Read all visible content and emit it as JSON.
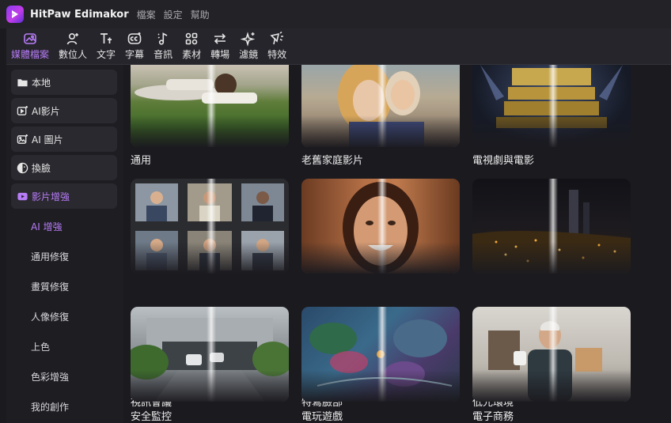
{
  "app": {
    "title": "HitPaw Edimakor",
    "menu": [
      "檔案",
      "設定",
      "幫助"
    ]
  },
  "toolbar": {
    "accent_color": "#b77cf7",
    "tabs": [
      {
        "label": "媒體檔案",
        "icon": "media-icon",
        "active": true
      },
      {
        "label": "數位人",
        "icon": "avatar-add-icon",
        "active": false
      },
      {
        "label": "文字",
        "icon": "text-icon",
        "active": false
      },
      {
        "label": "字幕",
        "icon": "subtitle-icon",
        "active": false
      },
      {
        "label": "音訊",
        "icon": "audio-icon",
        "active": false
      },
      {
        "label": "素材",
        "icon": "assets-icon",
        "active": false
      },
      {
        "label": "轉場",
        "icon": "transition-icon",
        "active": false
      },
      {
        "label": "濾鏡",
        "icon": "filter-icon",
        "active": false
      },
      {
        "label": "特效",
        "icon": "effects-icon",
        "active": false
      }
    ]
  },
  "sidebar": {
    "items": [
      {
        "label": "本地",
        "icon": "folder-icon",
        "active": false
      },
      {
        "label": "AI影片",
        "icon": "ai-video-icon",
        "active": false
      },
      {
        "label": "AI 圖片",
        "icon": "ai-image-icon",
        "active": false
      },
      {
        "label": "換臉",
        "icon": "face-swap-icon",
        "active": false
      },
      {
        "label": "影片增強",
        "icon": "video-enhance-icon",
        "active": true
      }
    ],
    "subitems": [
      {
        "label": "AI 增強",
        "active": true
      },
      {
        "label": "通用修復",
        "active": false
      },
      {
        "label": "畫質修復",
        "active": false
      },
      {
        "label": "人像修復",
        "active": false
      },
      {
        "label": "上色",
        "active": false
      },
      {
        "label": "色彩增強",
        "active": false
      },
      {
        "label": "我的創作",
        "active": false
      }
    ]
  },
  "grid": {
    "cards": [
      {
        "label": "通用",
        "scene": "grass-reading"
      },
      {
        "label": "老舊家庭影片",
        "scene": "family-portrait"
      },
      {
        "label": "電視劇與電影",
        "scene": "studio-logo"
      },
      {
        "label": "視訊會議",
        "scene": "video-call-grid"
      },
      {
        "label": "特寫臉部",
        "scene": "smiling-face"
      },
      {
        "label": "低光環境",
        "scene": "night-city"
      },
      {
        "label": "安全監控",
        "scene": "security-camera"
      },
      {
        "label": "電玩遊戲",
        "scene": "game-map"
      },
      {
        "label": "電子商務",
        "scene": "product-presenter"
      }
    ]
  }
}
